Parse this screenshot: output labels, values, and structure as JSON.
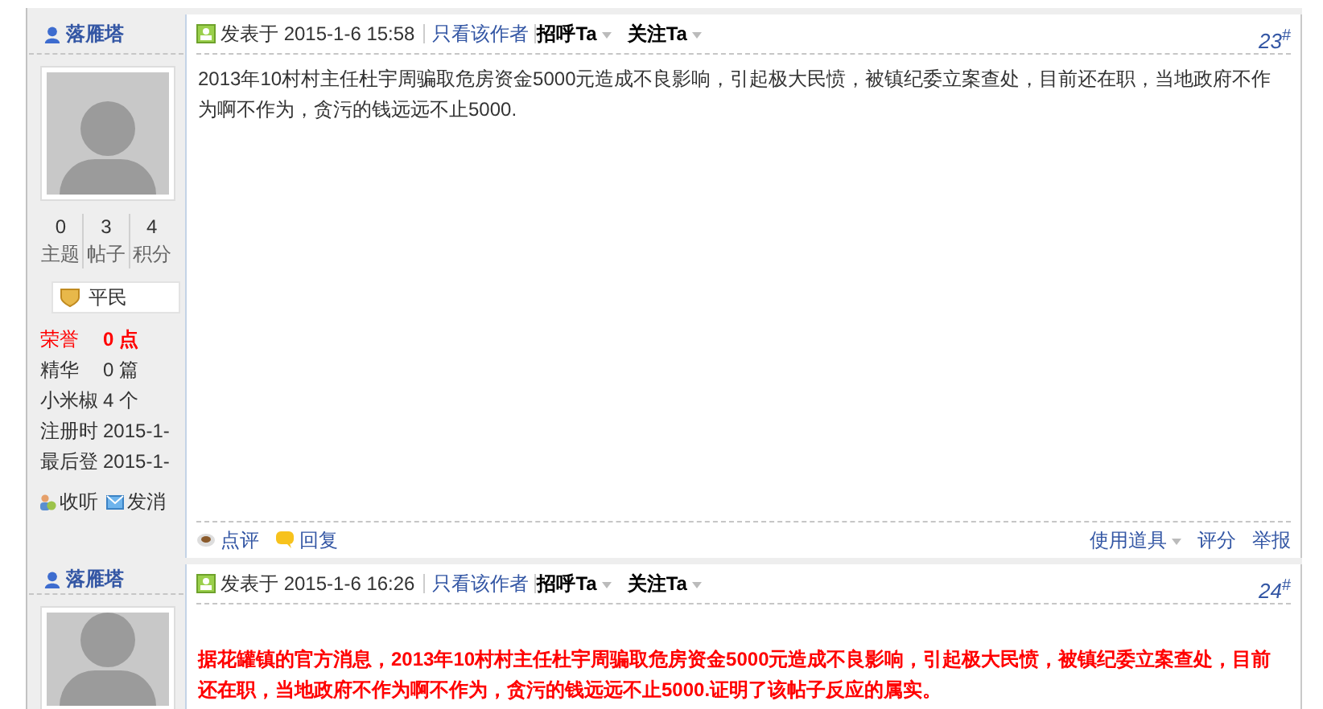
{
  "posts": [
    {
      "author": "落雁塔",
      "posted": "发表于 2015-1-6 15:58",
      "only_author": "只看该作者",
      "greet": "招呼Ta",
      "follow": "关注Ta",
      "floor": "23",
      "floor_mark": "#",
      "kind": "plain",
      "body": "2013年10村村主任杜宇周骗取危房资金5000元造成不良影响，引起极大民愤，被镇纪委立案查处，目前还在职，当地政府不作为啊不作为，贪污的钱远远不止5000.",
      "stats": [
        {
          "value": "0",
          "label": "主题"
        },
        {
          "value": "3",
          "label": "帖子"
        },
        {
          "value": "4",
          "label": "积分"
        }
      ],
      "rank": "平民",
      "details": [
        {
          "label": "荣誉",
          "value": "0 点",
          "kind": "highlight"
        },
        {
          "label": "精华",
          "value": "0 篇",
          "kind": "normal"
        },
        {
          "label": "小米椒",
          "value": "4 个",
          "kind": "normal"
        },
        {
          "label": "注册时",
          "value": "2015-1-",
          "kind": "normal"
        },
        {
          "label": "最后登",
          "value": "2015-1-",
          "kind": "normal"
        }
      ],
      "actions": [
        "收听",
        "发消"
      ],
      "footer_left": [
        "点评",
        "回复"
      ],
      "footer_right": [
        "使用道具",
        "评分",
        "举报"
      ]
    },
    {
      "author": "落雁塔",
      "posted": "发表于 2015-1-6 16:26",
      "only_author": "只看该作者",
      "greet": "招呼Ta",
      "follow": "关注Ta",
      "floor": "24",
      "floor_mark": "#",
      "kind": "emphasis",
      "body": "据花罐镇的官方消息，2013年10村村主任杜宇周骗取危房资金5000元造成不良影响，引起极大民愤，被镇纪委立案查处，目前还在职，当地政府不作为啊不作为，贪污的钱远远不止5000.证明了该帖子反应的属实。"
    }
  ]
}
